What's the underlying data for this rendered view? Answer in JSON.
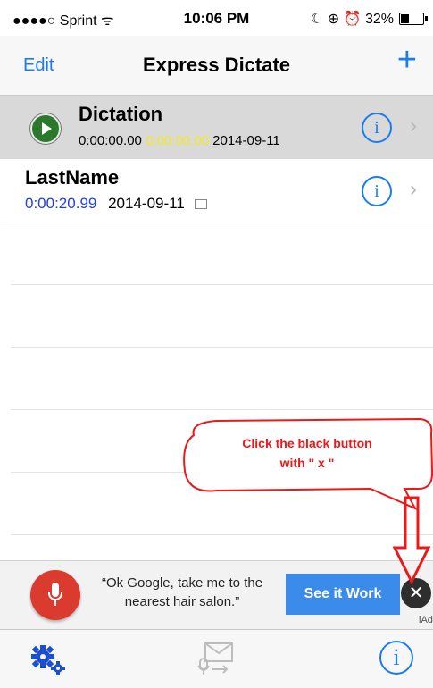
{
  "status_bar": {
    "carrier": "●●●●○ Sprint ᯤ",
    "time": "10:06 PM",
    "indicators": "☾ ⊕ ⏰ 32%",
    "battery_level": 0.32
  },
  "nav": {
    "edit_label": "Edit",
    "title": "Express Dictate",
    "add_label": "+"
  },
  "list": {
    "items": [
      {
        "title": "Dictation",
        "duration": "0:00:00.00",
        "recorded": "0:00:00.00",
        "date": "2014-09-11",
        "selected": true
      },
      {
        "title": "LastName",
        "duration": "0:00:20.99",
        "date": "2014-09-11",
        "selected": false
      }
    ]
  },
  "icons": {
    "info": "i",
    "chevron": "›"
  },
  "callout": {
    "line1": "Click the black button",
    "line2": "with \" x \""
  },
  "ad": {
    "text": "“Ok Google, take me to the nearest hair salon.”",
    "cta": "See it Work",
    "close": "✕",
    "label": "iAd"
  },
  "colors": {
    "accent": "#1a7cf5",
    "callout_red": "#ea1a1a",
    "yellow_duration": "#f2ea1d",
    "blue_duration": "#1f3ff5"
  }
}
